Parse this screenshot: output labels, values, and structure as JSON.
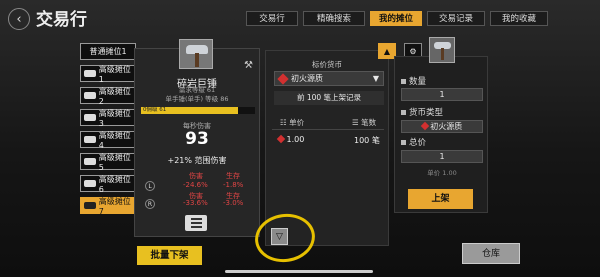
{
  "header": {
    "title": "交易行"
  },
  "tabs": [
    {
      "label": "交易行",
      "active": false
    },
    {
      "label": "精确搜索",
      "active": false
    },
    {
      "label": "我的摊位",
      "active": true
    },
    {
      "label": "交易记录",
      "active": false
    },
    {
      "label": "我的收藏",
      "active": false
    }
  ],
  "slots": [
    {
      "label": "普通摊位1"
    },
    {
      "label": "高级摊位1"
    },
    {
      "label": "高级摊位2"
    },
    {
      "label": "高级摊位3"
    },
    {
      "label": "高级摊位4"
    },
    {
      "label": "高级摊位5"
    },
    {
      "label": "高级摊位6"
    },
    {
      "label": "高级摊位7",
      "active": true
    }
  ],
  "item": {
    "name": "碎岩巨锤",
    "req_level": "需求等级 61",
    "type_level": "单手锤(单手)  等级 86",
    "level_bar_text": "0佣级 61",
    "level_fill_fraction": 0.85,
    "damage_label": "每秒伤害",
    "damage_value": "93",
    "range": "+21% 范围伤害",
    "compare": {
      "col1_header": "伤害",
      "col2_header": "生存",
      "left": {
        "key": "L",
        "v1": "-24.6%",
        "v2": "-1.8%"
      },
      "mid_headers": [
        "伤害",
        "生存"
      ],
      "right": {
        "key": "R",
        "v1": "-33.6%",
        "v2": "-3.0%"
      }
    }
  },
  "market": {
    "currency_label": "标价货币",
    "currency_selected": "初火源质",
    "first100": "前 100 笔上架记录",
    "col_price": "单价",
    "col_count": "笔数",
    "rows": [
      {
        "price": "1.00",
        "count": "100 笔"
      }
    ]
  },
  "listing": {
    "qty_label": "数量",
    "qty_value": "1",
    "currency_type_label": "货币类型",
    "currency_type_value": "初火源质",
    "total_label": "总价",
    "total_value": "1",
    "unit_price_text": "单价 1.00",
    "list_button": "上架"
  },
  "bottom": {
    "bulk_delist": "批量下架",
    "warehouse": "仓库"
  },
  "colors": {
    "accent": "#e8a630",
    "yellow": "#e8c020",
    "negative": "#e04545",
    "highlight": "#e6c000"
  }
}
